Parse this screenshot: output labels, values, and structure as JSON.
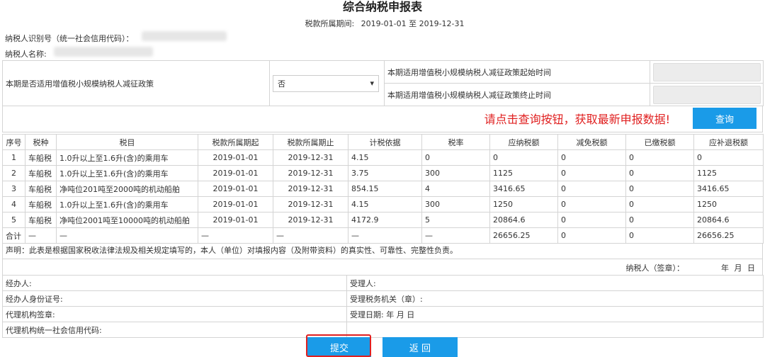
{
  "form": {
    "title": "综合纳税申报表",
    "period_label": "税款所属期间:",
    "period_value": "2019-01-01 至 2019-12-31",
    "taxpayer_id_label": "纳税人识别号（统一社会信用代码）：",
    "taxpayer_name_label": "纳税人名称:"
  },
  "policy": {
    "question": "本期是否适用增值税小规模纳税人减征政策",
    "selected": "否",
    "start_label": "本期适用增值税小规模纳税人减征政策起始时间",
    "end_label": "本期适用增值税小规模纳税人减征政策终止时间"
  },
  "query": {
    "hint": "请点击查询按钮，获取最新申报数据!",
    "button": "查询"
  },
  "table": {
    "headers": [
      "序号",
      "税种",
      "税目",
      "税款所属期起",
      "税款所属期止",
      "计税依据",
      "税率",
      "应纳税额",
      "减免税额",
      "已缴税额",
      "应补退税额"
    ],
    "rows": [
      [
        "1",
        "车船税",
        "1.0升以上至1.6升(含)的乘用车",
        "2019-01-01",
        "2019-12-31",
        "4.15",
        "0",
        "0",
        "0",
        "0",
        "0"
      ],
      [
        "2",
        "车船税",
        "1.0升以上至1.6升(含)的乘用车",
        "2019-01-01",
        "2019-12-31",
        "3.75",
        "300",
        "1125",
        "0",
        "0",
        "1125"
      ],
      [
        "3",
        "车船税",
        "净吨位201吨至2000吨的机动船舶",
        "2019-01-01",
        "2019-12-31",
        "854.15",
        "4",
        "3416.65",
        "0",
        "0",
        "3416.65"
      ],
      [
        "4",
        "车船税",
        "1.0升以上至1.6升(含)的乘用车",
        "2019-01-01",
        "2019-12-31",
        "4.15",
        "300",
        "1250",
        "0",
        "0",
        "1250"
      ],
      [
        "5",
        "车船税",
        "净吨位2001吨至10000吨的机动船舶",
        "2019-01-01",
        "2019-12-31",
        "4172.9",
        "5",
        "20864.6",
        "0",
        "0",
        "20864.6"
      ]
    ],
    "total": [
      "合计",
      "—",
      "—",
      "—",
      "—",
      "—",
      "—",
      "26656.25",
      "0",
      "0",
      "26656.25"
    ]
  },
  "declaration": "声明：此表是根据国家税收法律法规及相关规定填写的，本人（单位）对填报内容（及附带资料）的真实性、可靠性、完整性负责。",
  "signature": {
    "taxpayer_sign": "纳税人（签章）：",
    "date": "年 月 日"
  },
  "agent": {
    "handler": "经办人:",
    "receiver": "受理人:",
    "handler_id": "经办人身份证号:",
    "tax_office": "受理税务机关（章）:",
    "agency_sign": "代理机构签章:",
    "accept_date": "受理日期:   年 月 日",
    "agency_code": "代理机构统一社会信用代码:"
  },
  "buttons": {
    "submit": "提交",
    "back": "返 回"
  },
  "colors": {
    "primary": "#1a9be8",
    "hint_red": "#e02020"
  }
}
